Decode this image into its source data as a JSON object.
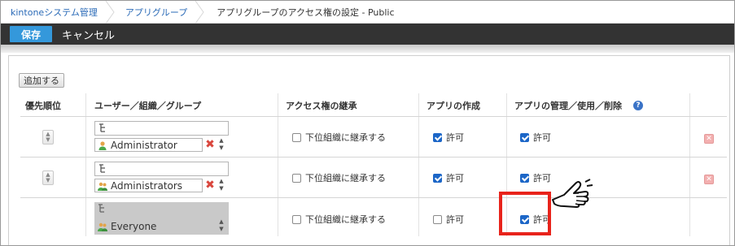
{
  "breadcrumb": {
    "items": [
      "kintoneシステム管理",
      "アプリグループ",
      "アプリグループのアクセス権の設定 - Public"
    ]
  },
  "toolbar": {
    "save_label": "保存",
    "cancel_label": "キャンセル"
  },
  "panel": {
    "add_label": "追加する"
  },
  "table": {
    "headers": [
      "優先順位",
      "ユーザー／組織／グループ",
      "アクセス権の継承",
      "アプリの作成",
      "アプリの管理／使用／削除"
    ],
    "help_icon": "?",
    "rows": [
      {
        "entity": "Administrator",
        "entity_icon": "user-icon",
        "inherit_label": "下位組織に継承する",
        "inherit": false,
        "create_label": "許可",
        "create": true,
        "manage_label": "許可",
        "manage": true,
        "order_up": "▲",
        "order_down": "▼",
        "delete_mark": "✖",
        "sort_up": "▲",
        "sort_down": "▼",
        "row_delete": "✕"
      },
      {
        "entity": "Administrators",
        "entity_icon": "group-icon",
        "inherit_label": "下位組織に継承する",
        "inherit": false,
        "create_label": "許可",
        "create": true,
        "manage_label": "許可",
        "manage": true,
        "order_up": "▲",
        "order_down": "▼",
        "delete_mark": "✖",
        "sort_up": "▲",
        "sort_down": "▼",
        "row_delete": "✕"
      },
      {
        "entity": "Everyone",
        "entity_icon": "group-icon",
        "inherit_label": "下位組織に継承する",
        "inherit": false,
        "create_label": "許可",
        "create": false,
        "manage_label": "許可",
        "manage": true,
        "sort_up": "▲",
        "sort_down": "▼"
      }
    ]
  },
  "colors": {
    "accent": "#3498db",
    "highlight": "#e8231b",
    "checkbox": "#1c66c7",
    "toolbar": "#333333"
  }
}
